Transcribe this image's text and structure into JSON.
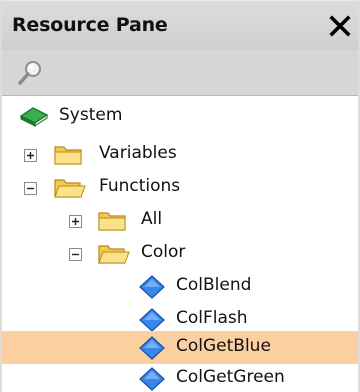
{
  "pane": {
    "title": "Resource Pane"
  },
  "tree": {
    "root": {
      "label": "System"
    },
    "variables": {
      "label": "Variables",
      "state": "collapsed"
    },
    "functions": {
      "label": "Functions",
      "state": "expanded"
    },
    "all": {
      "label": "All",
      "state": "collapsed"
    },
    "color": {
      "label": "Color",
      "state": "expanded"
    },
    "items": [
      {
        "label": "ColBlend",
        "selected": false
      },
      {
        "label": "ColFlash",
        "selected": false
      },
      {
        "label": "ColGetBlue",
        "selected": true
      },
      {
        "label": "ColGetGreen",
        "selected": false
      }
    ]
  },
  "colors": {
    "selection": "#fbcf9f",
    "folder": "#f5d16a",
    "diamond": "#2f7be0",
    "book": "#1d8a3a"
  }
}
